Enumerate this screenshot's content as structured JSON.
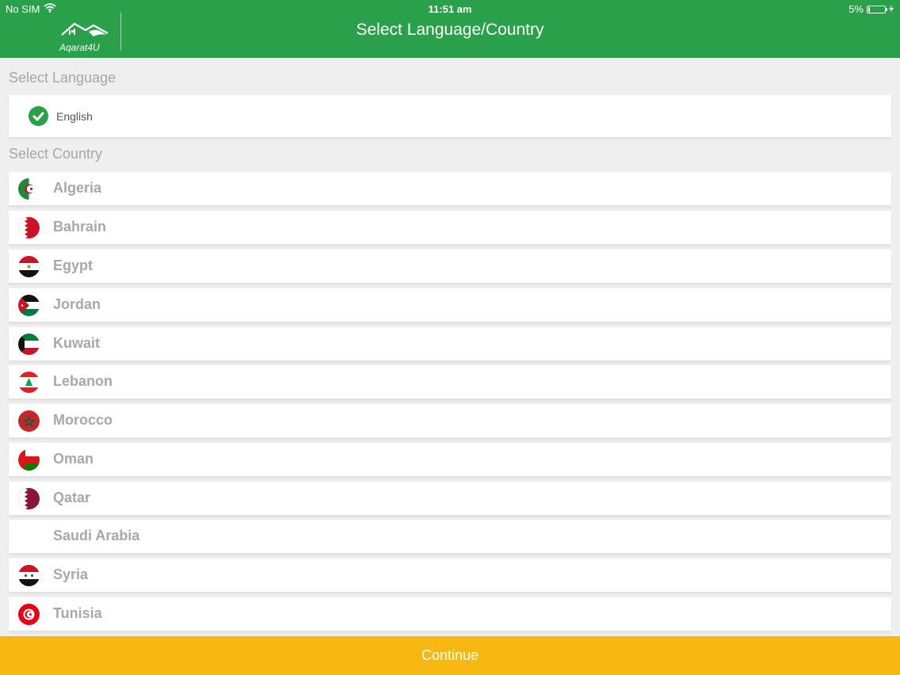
{
  "status_bar": {
    "carrier": "No SIM",
    "time": "11:51 am",
    "battery": "5%"
  },
  "header": {
    "title": "Select Language/Country",
    "logo_text": "Aqarat4U"
  },
  "language_section": {
    "heading": "Select Language",
    "selected": "English"
  },
  "country_section": {
    "heading": "Select Country",
    "countries": [
      {
        "name": "Algeria",
        "flag": "algeria-flag-icon"
      },
      {
        "name": "Bahrain",
        "flag": "bahrain-flag-icon"
      },
      {
        "name": "Egypt",
        "flag": "egypt-flag-icon"
      },
      {
        "name": "Jordan",
        "flag": "jordan-flag-icon"
      },
      {
        "name": "Kuwait",
        "flag": "kuwait-flag-icon"
      },
      {
        "name": "Lebanon",
        "flag": "lebanon-flag-icon"
      },
      {
        "name": "Morocco",
        "flag": "morocco-flag-icon"
      },
      {
        "name": "Oman",
        "flag": "oman-flag-icon"
      },
      {
        "name": "Qatar",
        "flag": "qatar-flag-icon"
      },
      {
        "name": "Saudi Arabia",
        "flag": ""
      },
      {
        "name": "Syria",
        "flag": "syria-flag-icon"
      },
      {
        "name": "Tunisia",
        "flag": "tunisia-flag-icon"
      }
    ]
  },
  "footer": {
    "continue_label": "Continue"
  },
  "colors": {
    "header": "#2ba04a",
    "button": "#f7b812",
    "background": "#efefef",
    "country_text": "#a8a8a8"
  }
}
